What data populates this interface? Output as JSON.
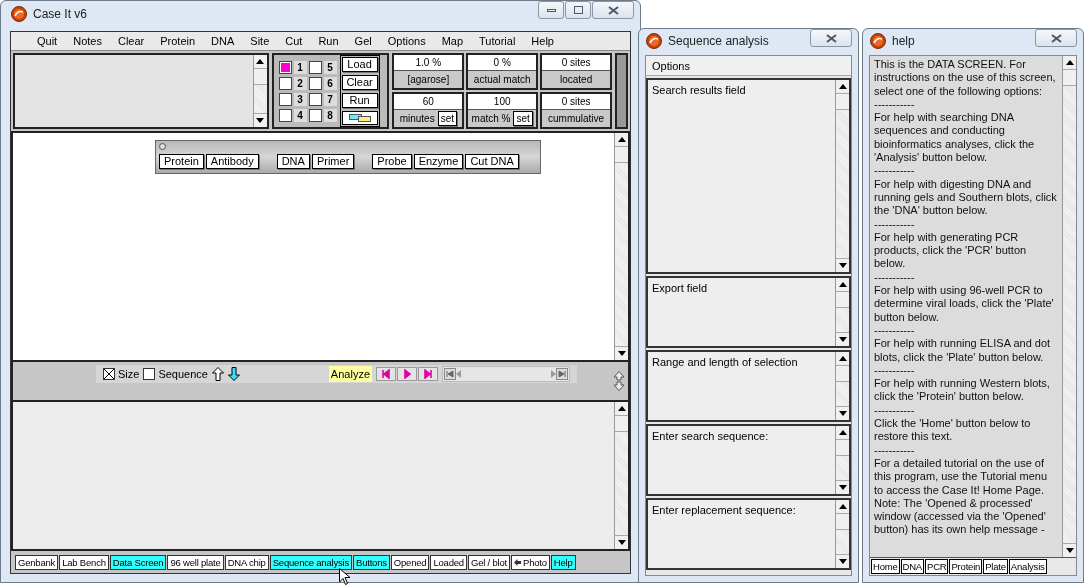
{
  "main_window": {
    "title": "Case It v6",
    "menu": [
      "Quit",
      "Notes",
      "Clear",
      "Protein",
      "DNA",
      "Site",
      "Cut",
      "Run",
      "Gel",
      "Options",
      "Map",
      "Tutorial",
      "Help"
    ],
    "lanes": [
      {
        "number": "1",
        "checked": true
      },
      {
        "number": "2",
        "checked": false
      },
      {
        "number": "3",
        "checked": false
      },
      {
        "number": "4",
        "checked": false
      },
      {
        "number": "5",
        "checked": false
      },
      {
        "number": "6",
        "checked": false
      },
      {
        "number": "7",
        "checked": false
      },
      {
        "number": "8",
        "checked": false
      }
    ],
    "lane_buttons": [
      "Load",
      "Clear",
      "Run"
    ],
    "readouts": [
      {
        "value": "1.0 %",
        "label": "[agarose]"
      },
      {
        "value": "0 %",
        "label": "actual match"
      },
      {
        "value": "0 sites",
        "label": "located"
      },
      {
        "value": "60",
        "label": "minutes",
        "button": "set"
      },
      {
        "value": "100",
        "label": "match %",
        "button": "set"
      },
      {
        "value": "0 sites",
        "label": "cummulative"
      }
    ],
    "palette": [
      [
        "Protein",
        "Antibody"
      ],
      [
        "DNA",
        "Primer"
      ],
      [
        "Probe",
        "Enzyme",
        "Cut DNA"
      ]
    ],
    "checkboxes": [
      {
        "label": "Size",
        "checked": true
      },
      {
        "label": "Sequence",
        "checked": false
      }
    ],
    "analyze": "Analyze",
    "bottom_buttons": [
      {
        "label": "Genbank",
        "highlighted": false,
        "kind": "plain"
      },
      {
        "label": "Lab Bench",
        "highlighted": false,
        "kind": "plain"
      },
      {
        "label": "Data Screen",
        "highlighted": true,
        "kind": "plain"
      },
      {
        "label": "96 well plate",
        "highlighted": false,
        "kind": "plain"
      },
      {
        "label": "DNA chip",
        "highlighted": false,
        "kind": "plain"
      },
      {
        "label": "Sequence analysis",
        "highlighted": true,
        "kind": "plain"
      },
      {
        "label": "Buttons",
        "highlighted": true,
        "kind": "plain"
      },
      {
        "label": "Opened",
        "highlighted": false,
        "kind": "plain"
      },
      {
        "label": "Loaded",
        "highlighted": false,
        "kind": "plain"
      },
      {
        "label": "Gel / blot",
        "highlighted": false,
        "kind": "plain"
      },
      {
        "label": "Photo",
        "highlighted": false,
        "kind": "arrow"
      },
      {
        "label": "Help",
        "highlighted": true,
        "kind": "plain"
      }
    ]
  },
  "sequence_window": {
    "title": "Sequence analysis",
    "menu": "Options",
    "fields": [
      "Search results field",
      "Export field",
      "Range and length of selection",
      "Enter search sequence:",
      "Enter replacement sequence:"
    ]
  },
  "help_window": {
    "title": "help",
    "paragraphs": [
      "This is the DATA SCREEN.  For instructions on the use of this screen, select one of the following options:",
      "-----------",
      "For help with searching DNA sequences and conducting bioinformatics analyses, click the 'Analysis' button below.",
      "-----------",
      "For help with digesting DNA and running gels and Southern blots, click the 'DNA' button below.",
      "-----------",
      "For help with generating PCR products, click the 'PCR' button below.",
      "-----------",
      "For help with using 96-well PCR to determine viral loads, click the 'Plate' button below.",
      "-----------",
      "For help with running ELISA and dot blots, click the 'Plate' button below.",
      "-----------",
      "For help with running Western blots, click the 'Protein' button below.",
      "-----------",
      "Click the 'Home' button below to restore this text.",
      "-----------",
      "For a detailed tutorial on the use of this program, use the Tutorial menu to access the Case It! Home Page.",
      "Note: The 'Opened & processed' window (accessed via the 'Opened' button) has its own help message -"
    ],
    "buttons": [
      "Home",
      "DNA",
      "PCR",
      "Protein",
      "Plate",
      "Analysis"
    ]
  }
}
